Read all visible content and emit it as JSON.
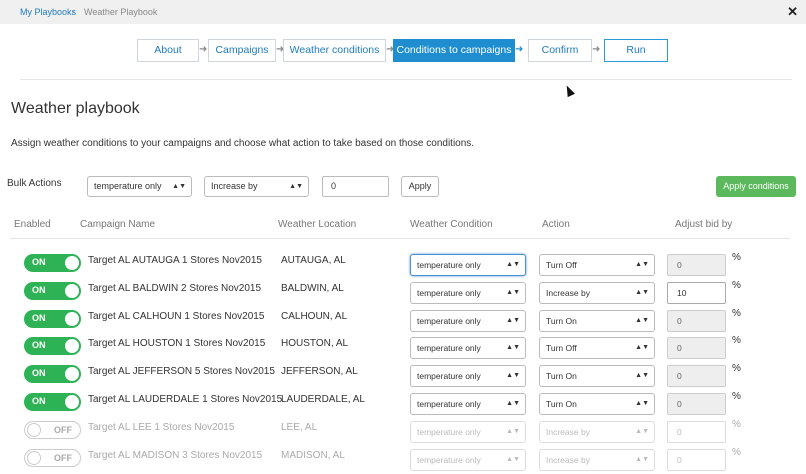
{
  "breadcrumb": {
    "parent": "My Playbooks",
    "current": "Weather Playbook"
  },
  "steps": [
    "About",
    "Campaigns",
    "Weather conditions",
    "Conditions to campaigns",
    "Confirm",
    "Run"
  ],
  "page": {
    "title": "Weather playbook",
    "description": "Assign weather conditions to your campaigns and choose what action to take based on those conditions."
  },
  "bulk": {
    "label": "Bulk Actions",
    "condition": "temperature only",
    "action": "Increase by",
    "amount": "0",
    "apply_label": "Apply",
    "apply_conditions_label": "Apply conditions"
  },
  "table": {
    "headers": [
      "Enabled",
      "Campaign Name",
      "Weather Location",
      "Weather Condition",
      "Action",
      "Adjust bid by"
    ],
    "pct_symbol": "%",
    "rows": [
      {
        "toggle": "ON",
        "name": "Target AL AUTAUGA 1 Stores Nov2015",
        "location": "AUTAUGA, AL",
        "condition": "temperature only",
        "action": "Turn Off",
        "bid": "0"
      },
      {
        "toggle": "ON",
        "name": "Target AL BALDWIN 2 Stores Nov2015",
        "location": "BALDWIN, AL",
        "condition": "temperature only",
        "action": "Increase by",
        "bid": "10"
      },
      {
        "toggle": "ON",
        "name": "Target AL CALHOUN 1 Stores Nov2015",
        "location": "CALHOUN, AL",
        "condition": "temperature only",
        "action": "Turn On",
        "bid": "0"
      },
      {
        "toggle": "ON",
        "name": "Target AL HOUSTON 1 Stores Nov2015",
        "location": "HOUSTON, AL",
        "condition": "temperature only",
        "action": "Turn Off",
        "bid": "0"
      },
      {
        "toggle": "ON",
        "name": "Target AL JEFFERSON 5 Stores Nov2015",
        "location": "JEFFERSON, AL",
        "condition": "temperature only",
        "action": "Turn On",
        "bid": "0"
      },
      {
        "toggle": "ON",
        "name": "Target AL LAUDERDALE 1 Stores Nov2015",
        "location": "LAUDERDALE, AL",
        "condition": "temperature only",
        "action": "Turn On",
        "bid": "0"
      },
      {
        "toggle": "OFF",
        "name": "Target AL LEE 1 Stores Nov2015",
        "location": "LEE, AL",
        "condition": "temperature only",
        "action": "Increase by",
        "bid": "0"
      },
      {
        "toggle": "OFF",
        "name": "Target AL MADISON 3 Stores Nov2015",
        "location": "MADISON, AL",
        "condition": "temperature only",
        "action": "Increase by",
        "bid": "0"
      }
    ]
  },
  "icons": {
    "close": "close-icon",
    "caret": "select-caret-icon",
    "step_arrow": "chevron-right-icon"
  },
  "colors": {
    "accent": "#1f8ed1",
    "toggle_on": "#2db355",
    "apply_conditions": "#5cb85c"
  }
}
